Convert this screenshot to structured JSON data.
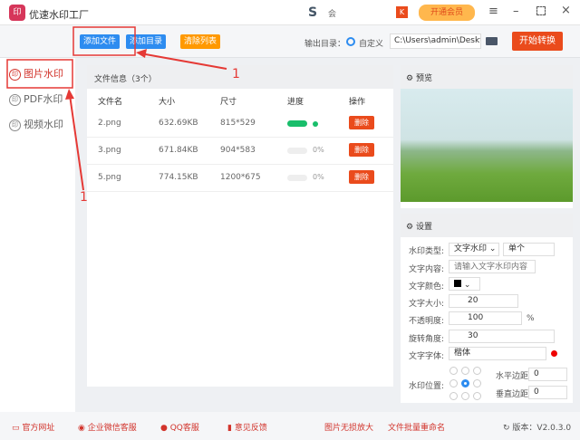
{
  "app": {
    "title": "优速水印工厂",
    "logo_text": "印",
    "vip": "开通会员",
    "user": "会"
  },
  "toolbar": {
    "add_file": "添加文件",
    "add_dir": "添加目录",
    "clear": "清除列表",
    "output_label": "输出目录：",
    "custom": "自定义",
    "path": "C:\\Users\\admin\\Deskto",
    "start": "开始转换"
  },
  "sidebar": {
    "items": [
      {
        "label": "图片水印"
      },
      {
        "label": "PDF水印"
      },
      {
        "label": "视频水印"
      }
    ]
  },
  "files": {
    "header": "文件信息（3个）",
    "columns": [
      "文件名",
      "大小",
      "尺寸",
      "进度",
      "操作"
    ],
    "rows": [
      {
        "name": "2.png",
        "size": "632.69KB",
        "dim": "815*529",
        "progress": 100,
        "pct": "",
        "action": "删除"
      },
      {
        "name": "3.png",
        "size": "671.84KB",
        "dim": "904*583",
        "progress": 0,
        "pct": "0%",
        "action": "删除"
      },
      {
        "name": "5.png",
        "size": "774.15KB",
        "dim": "1200*675",
        "progress": 0,
        "pct": "0%",
        "action": "删除"
      }
    ]
  },
  "preview": {
    "title": "预览"
  },
  "settings": {
    "title": "设置",
    "type_label": "水印类型:",
    "type": "文字水印",
    "mode": "单个",
    "content_label": "文字内容:",
    "content_placeholder": "请输入文字水印内容",
    "color_label": "文字颜色:",
    "size_label": "文字大小:",
    "size": "20",
    "opacity_label": "不透明度:",
    "opacity": "100",
    "pct": "%",
    "rotate_label": "旋转角度:",
    "rotate": "30",
    "font_label": "文字字体:",
    "font": "楷体",
    "pos_label": "水印位置:",
    "h_label": "水平边距",
    "h": "0",
    "v_label": "垂直边距",
    "v": "0"
  },
  "footer": {
    "items": [
      "官方网址",
      "企业微信客服",
      "QQ客服",
      "意见反馈",
      "图片无损放大",
      "文件批量重命名"
    ],
    "version": "版本：V2.0.3.0"
  },
  "annotations": {
    "label1": "1",
    "label2": "1"
  },
  "colors": {
    "accent": "#ea4b1c",
    "blue": "#2d8cf0",
    "orange": "#ff9900",
    "green": "#19be6b"
  }
}
